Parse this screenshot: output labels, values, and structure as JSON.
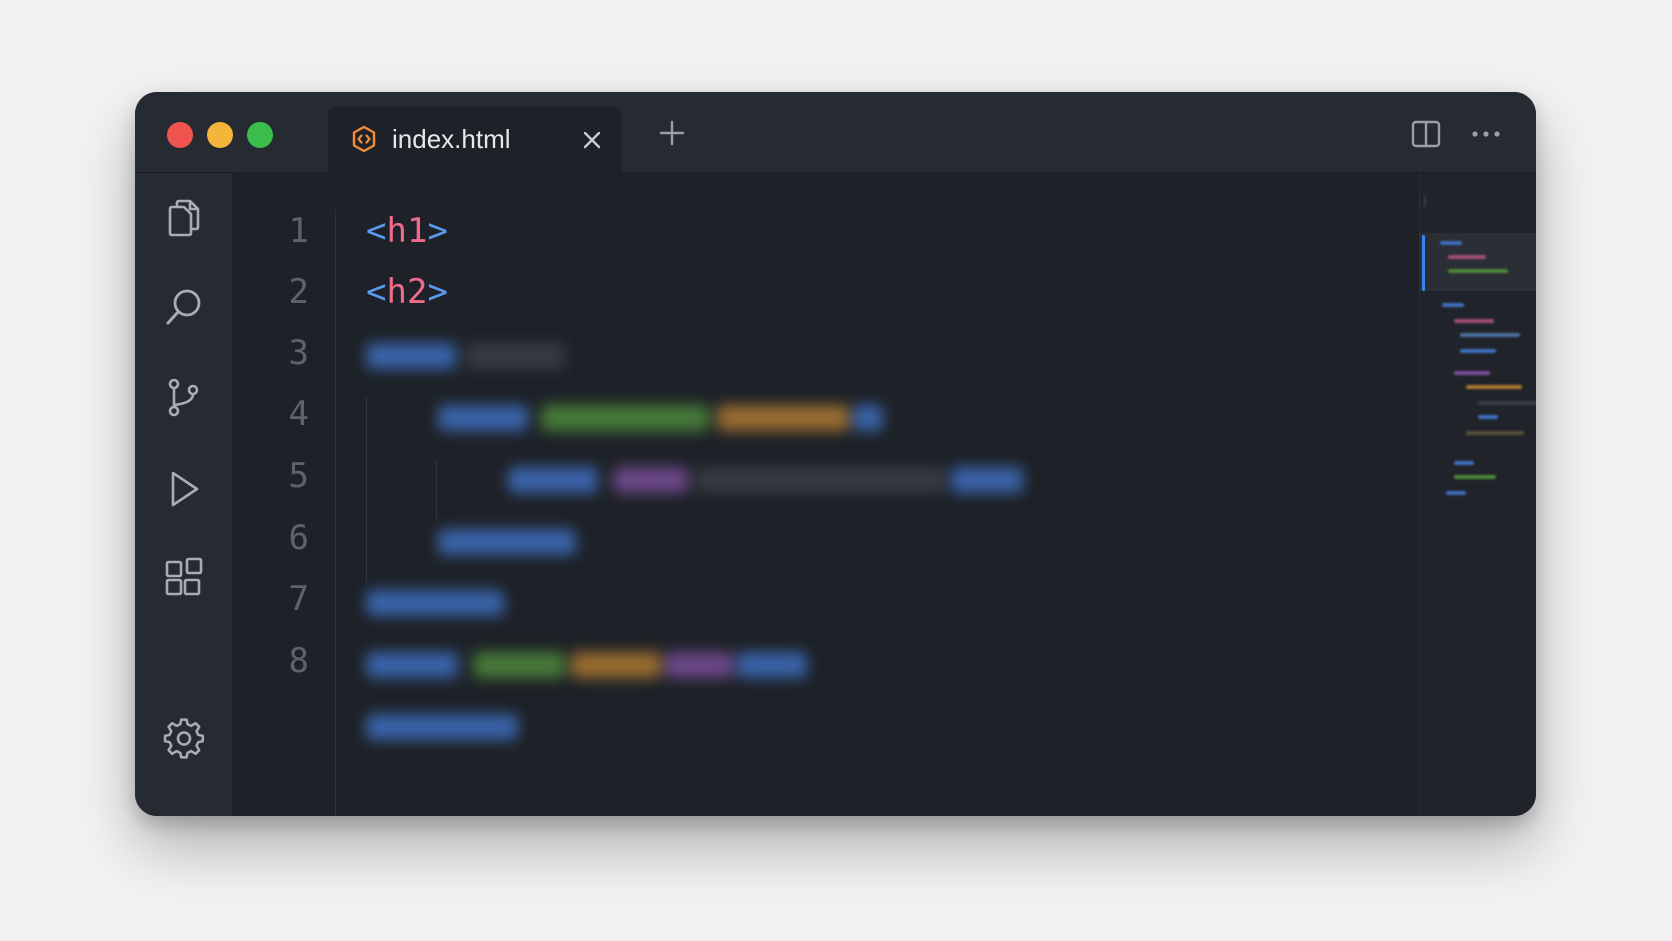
{
  "window": {
    "traffic_lights": {
      "close_color": "#f0544f",
      "minimize_color": "#f4b63a",
      "zoom_color": "#3cbd4b"
    }
  },
  "tabs": [
    {
      "label": "index.html",
      "icon": "html-file-icon",
      "icon_color": "#f28c38",
      "active": true
    }
  ],
  "titlebar": {
    "new_tab_icon": "plus-icon",
    "split_icon": "split-editor-icon",
    "more_icon": "ellipsis-icon"
  },
  "activity_bar": {
    "items": [
      {
        "name": "explorer",
        "icon": "files-icon"
      },
      {
        "name": "search",
        "icon": "search-icon"
      },
      {
        "name": "source-control",
        "icon": "source-control-icon"
      },
      {
        "name": "run",
        "icon": "run-icon"
      },
      {
        "name": "extensions",
        "icon": "extensions-icon"
      }
    ],
    "settings_icon": "gear-icon"
  },
  "editor": {
    "line_numbers": [
      "1",
      "2",
      "3",
      "4",
      "5",
      "6",
      "7",
      "8"
    ],
    "lines": [
      {
        "open": "<",
        "tag": "h1",
        "close": ">"
      },
      {
        "open": "<",
        "tag": "h2",
        "close": ">"
      }
    ],
    "colors": {
      "bracket": "#5a9bf0",
      "tag": "#ef6b8a",
      "attribute": "#7cc35a",
      "string": "#e0a24a",
      "keyword": "#b77ee0"
    }
  }
}
